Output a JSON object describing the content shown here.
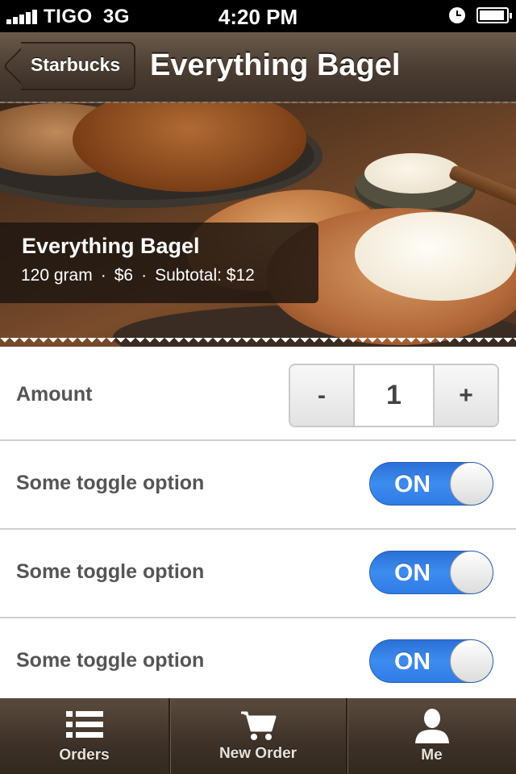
{
  "status_bar": {
    "carrier": "TIGO",
    "network": "3G",
    "time": "4:20 PM",
    "icons": [
      "signal-icon",
      "alarm-icon",
      "battery-icon"
    ],
    "battery_level": 0.95
  },
  "nav": {
    "back_label": "Starbucks",
    "title": "Everything Bagel"
  },
  "product": {
    "name": "Everything Bagel",
    "weight": "120 gram",
    "price": "$6",
    "subtotal": "Subtotal: $12",
    "separator": "·"
  },
  "amount": {
    "label": "Amount",
    "minus": "-",
    "value": "1",
    "plus": "+"
  },
  "options": [
    {
      "label": "Some toggle option",
      "state": "ON"
    },
    {
      "label": "Some toggle option",
      "state": "ON"
    },
    {
      "label": "Some toggle option",
      "state": "ON"
    }
  ],
  "tabs": [
    {
      "label": "Orders",
      "icon": "list-icon"
    },
    {
      "label": "New Order",
      "icon": "cart-icon"
    },
    {
      "label": "Me",
      "icon": "user-icon"
    }
  ],
  "colors": {
    "nav_brown": "#4a3c31",
    "toggle_blue": "#3d8cf0",
    "label_gray": "#555555"
  }
}
